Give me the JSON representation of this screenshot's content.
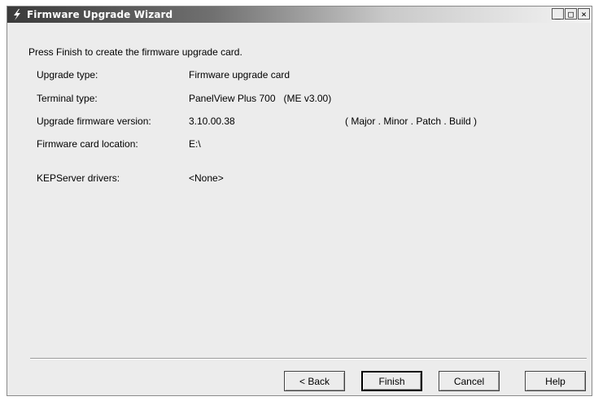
{
  "window": {
    "title": "Firmware Upgrade Wizard",
    "icon": "lightning-icon",
    "controls": {
      "minimize": "_",
      "maximize": "□",
      "close": "×"
    }
  },
  "intro": "Press Finish to create the firmware upgrade card.",
  "fields": [
    {
      "label": "Upgrade type:",
      "value": "Firmware upgrade card"
    },
    {
      "label": "Terminal type:",
      "value": "PanelView Plus 700   (ME v3.00)"
    },
    {
      "label": "Upgrade firmware version:",
      "value": "3.10.00.38",
      "note": "( Major . Minor . Patch . Build )"
    },
    {
      "label": "Firmware card location:",
      "value": "E:\\"
    },
    {
      "label": "KEPServer drivers:",
      "value": "<None>"
    }
  ],
  "buttons": {
    "back": "< Back",
    "finish": "Finish",
    "cancel": "Cancel",
    "help": "Help"
  }
}
